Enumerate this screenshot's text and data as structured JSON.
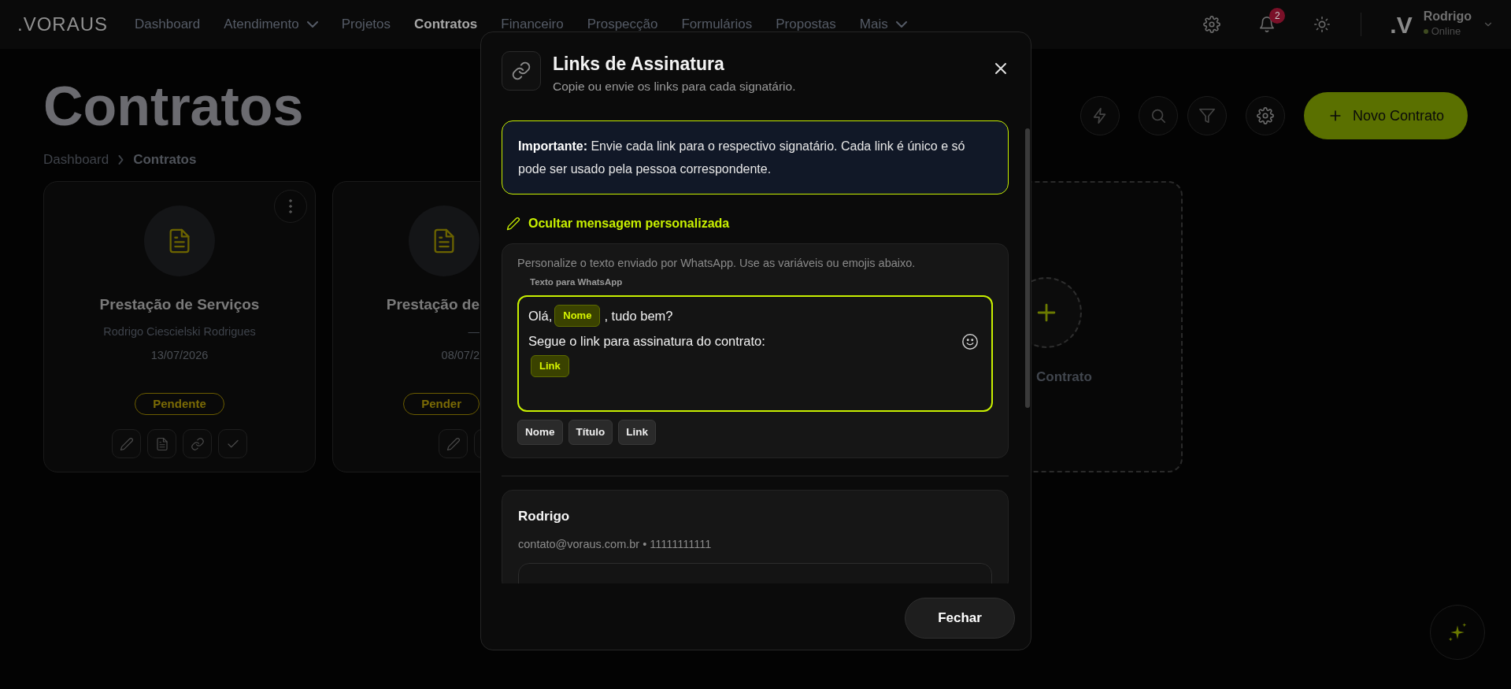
{
  "navbar": {
    "logo": ".VORAUS",
    "items": [
      {
        "label": "Dashboard",
        "selected": false,
        "dropdown": false
      },
      {
        "label": "Atendimento",
        "selected": false,
        "dropdown": true
      },
      {
        "label": "Projetos",
        "selected": false,
        "dropdown": false
      },
      {
        "label": "Contratos",
        "selected": true,
        "dropdown": false
      },
      {
        "label": "Financeiro",
        "selected": false,
        "dropdown": false
      },
      {
        "label": "Prospecção",
        "selected": false,
        "dropdown": false
      },
      {
        "label": "Formulários",
        "selected": false,
        "dropdown": false
      },
      {
        "label": "Propostas",
        "selected": false,
        "dropdown": false
      },
      {
        "label": "Mais",
        "selected": false,
        "dropdown": true
      }
    ],
    "notifications": "2",
    "user": {
      "avatar": ".V",
      "name": "Rodrigo",
      "status": "Online"
    }
  },
  "page": {
    "title": "Contratos",
    "breadcrumb": [
      "Dashboard",
      "Contratos"
    ],
    "primary_button": "Novo Contrato"
  },
  "cards": [
    {
      "title": "Prestação de Serviços",
      "person": "Rodrigo Ciescielski Rodrigues",
      "date": "13/07/2026",
      "status": "Pendente",
      "covered": false
    },
    {
      "title": "Prestação de",
      "person": "—",
      "date": "08/07/2",
      "status": "Pender",
      "covered": true
    }
  ],
  "new_card": {
    "label": "Contrato"
  },
  "modal": {
    "title": "Links de Assinatura",
    "subtitle": "Copie ou envie os links para cada signatário.",
    "notice": "**Importante:** Envie cada link para o respectivo signatário. Cada link é único e só pode ser usado pela pessoa correspondente.",
    "toggle_link": "Ocultar mensagem personalizada",
    "message": {
      "hint": "Personalize o texto enviado por WhatsApp. Use as variáveis ou emojis abaixo.",
      "field_label": "Texto para WhatsApp",
      "lines": [
        [
          {
            "kind": "text",
            "text": "Olá,"
          },
          {
            "kind": "token",
            "text": "Nome"
          },
          {
            "kind": "text",
            "text": ", tudo bem?"
          }
        ],
        [
          {
            "kind": "text",
            "text": "Segue o link para assinatura do contrato:"
          }
        ],
        [
          {
            "kind": "token",
            "text": "Link"
          }
        ]
      ],
      "variables": [
        "Nome",
        "Título",
        "Link"
      ]
    },
    "signers": [
      {
        "name": "Rodrigo",
        "contact": "contato@voraus.com.br • 11111111111"
      }
    ],
    "close_button": "Fechar"
  }
}
